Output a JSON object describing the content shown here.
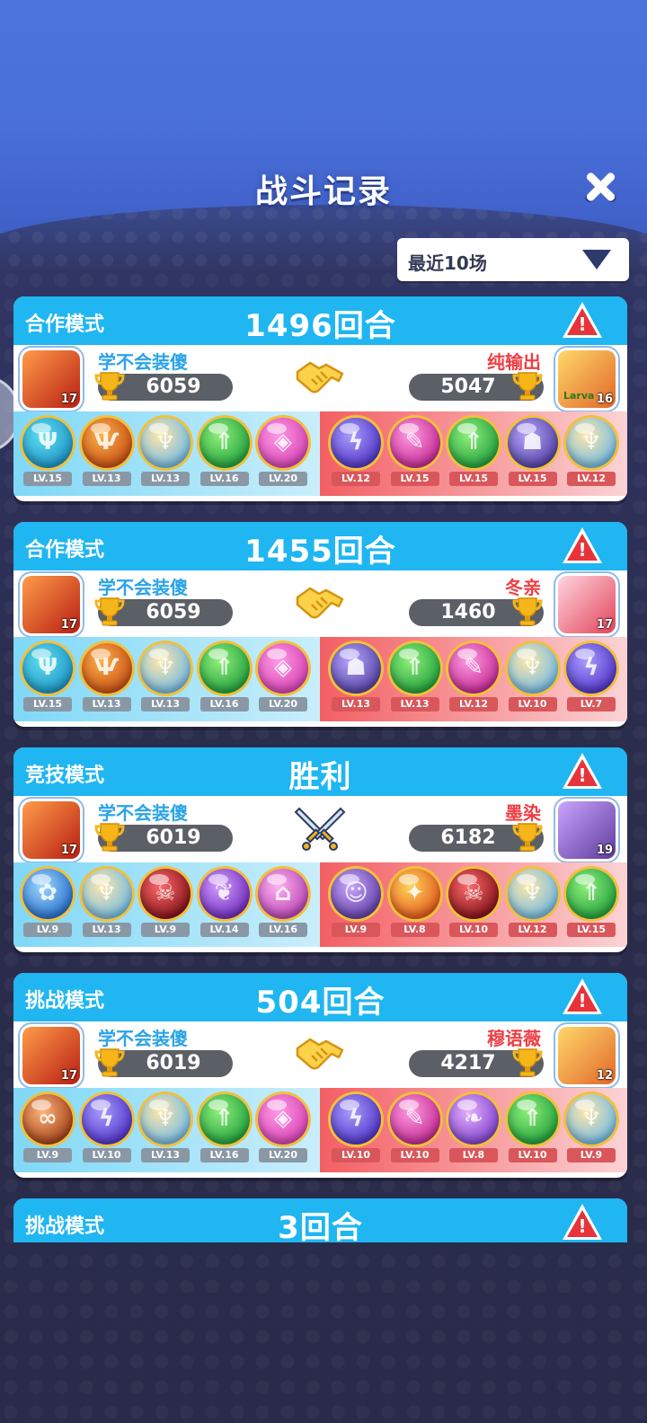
{
  "title": "战斗记录",
  "filter": {
    "label": "最近10场"
  },
  "colors": {
    "header_blue": "#1fb6f2",
    "player_name": "#2aa3e8",
    "opponent_name": "#ef3e43",
    "report_red": "#e8333b"
  },
  "records": [
    {
      "mode": "合作模式",
      "result": "1496回合",
      "center_icon": "handshake-icon",
      "player": {
        "name": "学不会装傻",
        "score": "6059",
        "level": "17"
      },
      "opponent": {
        "name": "纯输出",
        "score": "5047",
        "level": "16",
        "avatar_text": "Larva"
      },
      "player_pets": [
        {
          "lv": "LV.15",
          "icon": "cyan-orb"
        },
        {
          "lv": "LV.13",
          "icon": "phoenix-orb"
        },
        {
          "lv": "LV.13",
          "icon": "ghost-orb"
        },
        {
          "lv": "LV.16",
          "icon": "green-arrow-orb"
        },
        {
          "lv": "LV.20",
          "icon": "pink-shield-orb"
        }
      ],
      "opponent_pets": [
        {
          "lv": "LV.12",
          "icon": "purple-lightning-orb"
        },
        {
          "lv": "LV.15",
          "icon": "pink-feather-orb"
        },
        {
          "lv": "LV.15",
          "icon": "green-arrow-orb"
        },
        {
          "lv": "LV.15",
          "icon": "purple-ghost-orb"
        },
        {
          "lv": "LV.12",
          "icon": "ghost-orb"
        }
      ]
    },
    {
      "mode": "合作模式",
      "result": "1455回合",
      "center_icon": "handshake-icon",
      "player": {
        "name": "学不会装傻",
        "score": "6059",
        "level": "17"
      },
      "opponent": {
        "name": "冬亲",
        "score": "1460",
        "level": "17"
      },
      "player_pets": [
        {
          "lv": "LV.15",
          "icon": "cyan-orb"
        },
        {
          "lv": "LV.13",
          "icon": "phoenix-orb"
        },
        {
          "lv": "LV.13",
          "icon": "ghost-orb"
        },
        {
          "lv": "LV.16",
          "icon": "green-arrow-orb"
        },
        {
          "lv": "LV.20",
          "icon": "pink-shield-orb"
        }
      ],
      "opponent_pets": [
        {
          "lv": "LV.13",
          "icon": "purple-ghost-orb"
        },
        {
          "lv": "LV.13",
          "icon": "green-arrow-orb"
        },
        {
          "lv": "LV.12",
          "icon": "pink-feather-orb"
        },
        {
          "lv": "LV.10",
          "icon": "ghost-orb"
        },
        {
          "lv": "LV.7",
          "icon": "purple-lightning-orb"
        }
      ]
    },
    {
      "mode": "竞技模式",
      "result": "胜利",
      "center_icon": "crossed-swords-icon",
      "player": {
        "name": "学不会装傻",
        "score": "6019",
        "level": "17"
      },
      "opponent": {
        "name": "墨染",
        "score": "6182",
        "level": "19"
      },
      "player_pets": [
        {
          "lv": "LV.9",
          "icon": "blue-flower-orb"
        },
        {
          "lv": "LV.13",
          "icon": "ghost-orb"
        },
        {
          "lv": "LV.9",
          "icon": "venom-orb"
        },
        {
          "lv": "LV.14",
          "icon": "purple-sprout-orb"
        },
        {
          "lv": "LV.16",
          "icon": "pink-mushroom-orb"
        }
      ],
      "opponent_pets": [
        {
          "lv": "LV.9",
          "icon": "portrait-orb"
        },
        {
          "lv": "LV.8",
          "icon": "orange-star-orb"
        },
        {
          "lv": "LV.10",
          "icon": "venom-orb"
        },
        {
          "lv": "LV.12",
          "icon": "ghost-orb"
        },
        {
          "lv": "LV.15",
          "icon": "green-arrow-orb"
        }
      ]
    },
    {
      "mode": "挑战模式",
      "result": "504回合",
      "center_icon": "handshake-icon",
      "player": {
        "name": "学不会装傻",
        "score": "6019",
        "level": "17"
      },
      "opponent": {
        "name": "穆语薇",
        "score": "4217",
        "level": "12"
      },
      "player_pets": [
        {
          "lv": "LV.9",
          "icon": "infinity-orb"
        },
        {
          "lv": "LV.10",
          "icon": "purple-lightning-orb"
        },
        {
          "lv": "LV.13",
          "icon": "ghost-orb"
        },
        {
          "lv": "LV.16",
          "icon": "green-arrow-orb"
        },
        {
          "lv": "LV.20",
          "icon": "pink-shield-orb"
        }
      ],
      "opponent_pets": [
        {
          "lv": "LV.10",
          "icon": "purple-lightning-orb"
        },
        {
          "lv": "LV.10",
          "icon": "pink-feather-orb"
        },
        {
          "lv": "LV.8",
          "icon": "purple-butterfly-orb"
        },
        {
          "lv": "LV.10",
          "icon": "green-arrow-orb"
        },
        {
          "lv": "LV.9",
          "icon": "ghost-orb"
        }
      ]
    },
    {
      "mode": "挑战模式",
      "result": "3回合",
      "center_icon": "handshake-icon"
    }
  ]
}
